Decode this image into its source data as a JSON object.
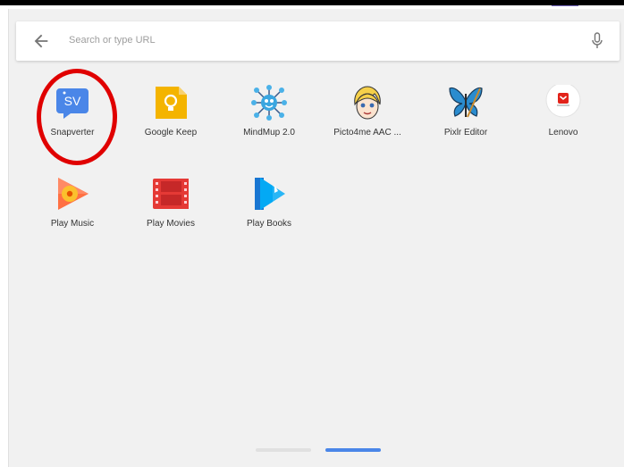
{
  "search": {
    "placeholder": "Search or type URL"
  },
  "apps": [
    {
      "label": "Snapverter",
      "icon": "snapverter-icon"
    },
    {
      "label": "Google Keep",
      "icon": "google-keep-icon"
    },
    {
      "label": "MindMup 2.0",
      "icon": "mindmup-icon"
    },
    {
      "label": "Picto4me AAC ...",
      "icon": "picto4me-icon"
    },
    {
      "label": "Pixlr Editor",
      "icon": "pixlr-editor-icon"
    },
    {
      "label": "Lenovo",
      "icon": "lenovo-icon"
    },
    {
      "label": "Play Music",
      "icon": "play-music-icon"
    },
    {
      "label": "Play Movies",
      "icon": "play-movies-icon"
    },
    {
      "label": "Play Books",
      "icon": "play-books-icon"
    }
  ],
  "pager": {
    "pages": 2,
    "active": 2
  },
  "colors": {
    "accent": "#4a86e8",
    "highlight": "#e00000",
    "launcher_bg": "#f1f1f1"
  }
}
